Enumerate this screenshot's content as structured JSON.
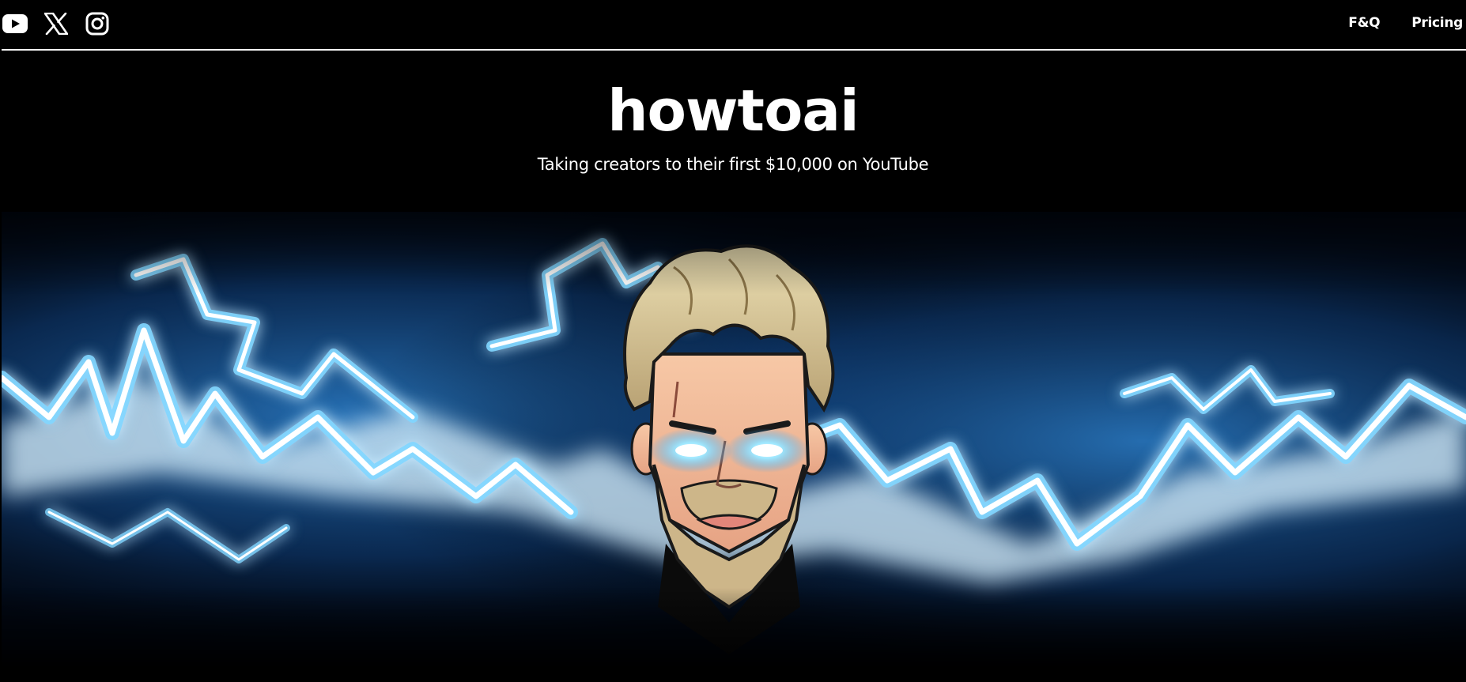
{
  "socials": [
    {
      "icon": "youtube-icon",
      "label": "YouTube"
    },
    {
      "icon": "x-icon",
      "label": "X"
    },
    {
      "icon": "instagram-icon",
      "label": "Instagram"
    }
  ],
  "nav": {
    "faq": "F&Q",
    "pricing": "Pricing"
  },
  "hero": {
    "title": "howtoai",
    "subtitle": "Taking creators to their first $10,000 on YouTube"
  },
  "banner": {
    "image": "lightning-avatar-illustration"
  },
  "colors": {
    "background": "#000000",
    "text": "#ffffff",
    "lightning": "#6fd8ff",
    "glow": "#2b7fd0"
  }
}
